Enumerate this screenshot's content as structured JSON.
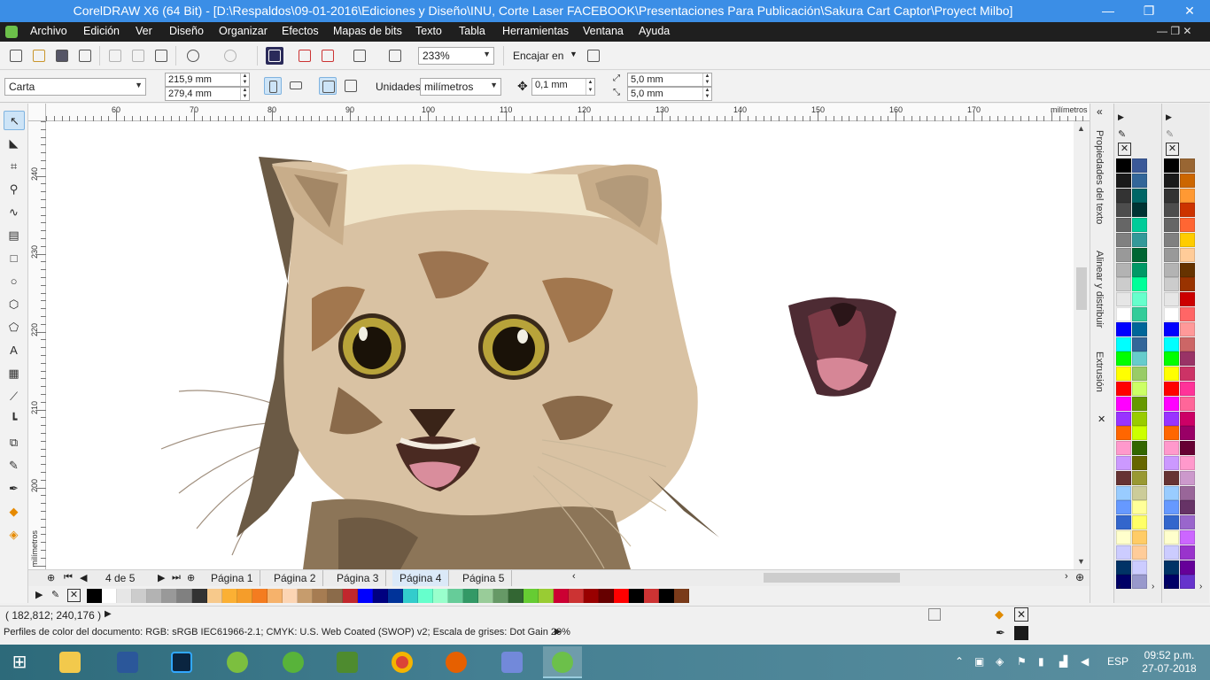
{
  "window": {
    "title": "CorelDRAW X6 (64 Bit) - [D:\\Respaldos\\09-01-2016\\Ediciones y Diseño\\INU, Corte Laser FACEBOOK\\Presentaciones Para Publicación\\Sakura Cart Captor\\Proyect Milbo]",
    "min": "—",
    "max": "❐",
    "close": "✕"
  },
  "menu": {
    "items": [
      "Archivo",
      "Edición",
      "Ver",
      "Diseño",
      "Organizar",
      "Efectos",
      "Mapas de bits",
      "Texto",
      "Tabla",
      "Herramientas",
      "Ventana",
      "Ayuda"
    ],
    "doc_controls": "— ❐ ✕"
  },
  "toolbar": {
    "zoom": "233%",
    "snap_label": "Encajar en"
  },
  "property_bar": {
    "page_size": "Carta",
    "width": "215,9 mm",
    "height": "279,4 mm",
    "units_label": "Unidades:",
    "units_value": "milímetros",
    "nudge": "0,1 mm",
    "dup_x": "5,0 mm",
    "dup_y": "5,0 mm"
  },
  "ruler": {
    "top_labels": [
      "60",
      "70",
      "80",
      "90",
      "100",
      "110",
      "120",
      "130",
      "140",
      "150",
      "160",
      "170"
    ],
    "unit": "milímetros",
    "left_labels": [
      "240",
      "230",
      "220",
      "210",
      "200"
    ],
    "left_unit": "milímetros"
  },
  "pages": {
    "counter": "4 de 5",
    "tabs": [
      "Página 1",
      "Página 2",
      "Página 3",
      "Página 4",
      "Página 5"
    ],
    "active_index": 3
  },
  "status": {
    "coords": "( 182,812; 240,176 )",
    "profiles": "Perfiles de color del documento: RGB: sRGB IEC61966-2.1; CMYK: U.S. Web Coated (SWOP) v2; Escala de grises: Dot Gain 20%"
  },
  "dockers": {
    "tabs": [
      "Propiedades del texto",
      "Alinear y distribuir",
      "Extrusión"
    ]
  },
  "palette_bottom": [
    "#000000",
    "#ffffff",
    "#e6e6e6",
    "#cccccc",
    "#b3b3b3",
    "#999999",
    "#808080",
    "#333333",
    "#f7c98b",
    "#fbb034",
    "#f59d2a",
    "#f47c20",
    "#f6b26b",
    "#fcd5b4",
    "#c69c6d",
    "#a67c52",
    "#8b6b4a",
    "#c1272d",
    "#0000ff",
    "#000080",
    "#003399",
    "#33cccc",
    "#66ffcc",
    "#99ffcc",
    "#66cc99",
    "#339966",
    "#99cc99",
    "#669966",
    "#336633",
    "#66cc33",
    "#99cc33",
    "#cc0033",
    "#cc3333",
    "#990000",
    "#660000",
    "#ff0000",
    "#000000",
    "#cc3333",
    "#000000",
    "#7a3b1a"
  ],
  "palette_right_a": [
    "#000000",
    "#1a1a1a",
    "#333333",
    "#4d4d4d",
    "#666666",
    "#808080",
    "#999999",
    "#b3b3b3",
    "#cccccc",
    "#e6e6e6",
    "#ffffff",
    "#0000ff",
    "#00ffff",
    "#00ff00",
    "#ffff00",
    "#ff0000",
    "#ff00ff",
    "#9933ff",
    "#ff6600",
    "#ff99cc",
    "#cc99ff",
    "#663333",
    "#99ccff",
    "#6699ff",
    "#3366cc",
    "#ffffcc",
    "#ccccff",
    "#003366",
    "#000066"
  ],
  "palette_right_b": [
    "#3b5998",
    "#336699",
    "#006666",
    "#003333",
    "#00cc99",
    "#339999",
    "#006633",
    "#009966",
    "#00ff99",
    "#66ffcc",
    "#33cc99",
    "#006699",
    "#336699",
    "#66cccc",
    "#99cc66",
    "#ccff66",
    "#669900",
    "#99cc00",
    "#ccff00",
    "#336600",
    "#666600",
    "#999933",
    "#cccc99",
    "#ffff99",
    "#ffff66",
    "#ffcc66",
    "#ffcc99",
    "#ccccff",
    "#9999cc"
  ],
  "palette_right_c": [
    "#996633",
    "#cc6600",
    "#ff9933",
    "#cc3300",
    "#ff6633",
    "#ffcc00",
    "#ffcc99",
    "#663300",
    "#993300",
    "#cc0000",
    "#ff6666",
    "#ff9999",
    "#cc6666",
    "#993366",
    "#cc3366",
    "#ff3399",
    "#ff6699",
    "#cc0066",
    "#990066",
    "#660033",
    "#ff99cc",
    "#cc99cc",
    "#996699",
    "#663366",
    "#9966cc",
    "#cc66ff",
    "#9933cc",
    "#660099",
    "#6633cc"
  ],
  "taskbar": {
    "lang": "ESP",
    "time": "09:52 p.m.",
    "date": "27-07-2018"
  }
}
